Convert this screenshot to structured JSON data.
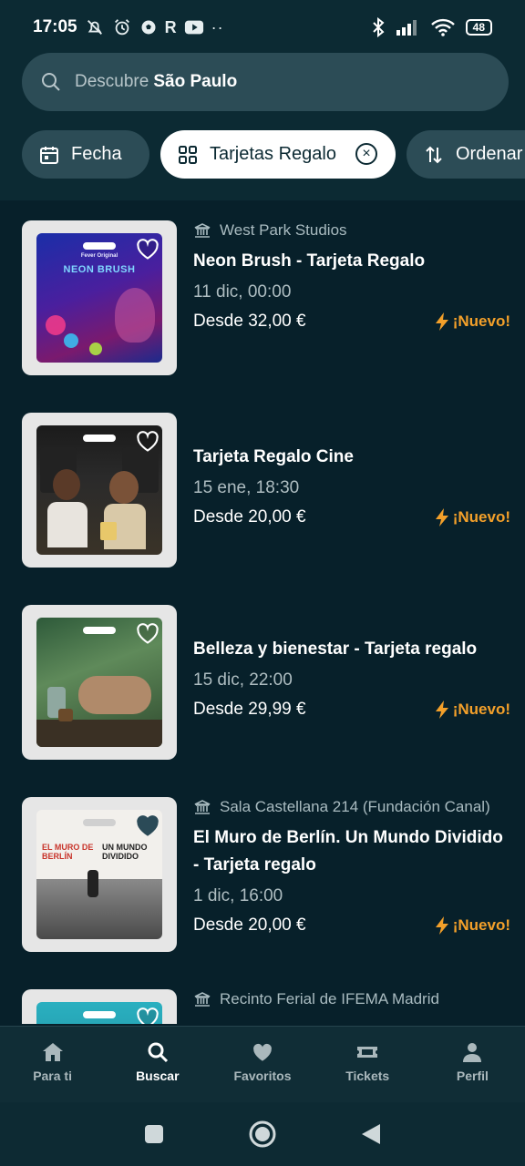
{
  "status_bar": {
    "time": "17:05",
    "left_icons": [
      "bell-off-icon",
      "alarm-icon",
      "soccer-icon",
      "r-icon",
      "youtube-icon",
      "more-dots-icon"
    ],
    "right_icons": [
      "bluetooth-icon",
      "signal-icon",
      "wifi-icon"
    ],
    "battery": "48"
  },
  "search": {
    "prefix": "Descubre",
    "city": "São Paulo"
  },
  "filters": {
    "date_label": "Fecha",
    "gift_label": "Tarjetas Regalo",
    "sort_label": "Ordenar"
  },
  "events": [
    {
      "venue": "West Park Studios",
      "title": "Neon Brush - Tarjeta Regalo",
      "date": "11 dic, 00:00",
      "price": "Desde 32,00 €",
      "badge": "¡Nuevo!",
      "card_text": "NEON BRUSH",
      "card_subtext": "Fever Original"
    },
    {
      "venue": "",
      "title": "Tarjeta Regalo Cine",
      "date": "15 ene, 18:30",
      "price": "Desde 20,00 €",
      "badge": "¡Nuevo!"
    },
    {
      "venue": "",
      "title": "Belleza y bienestar - Tarjeta regalo",
      "date": "15 dic, 22:00",
      "price": "Desde 29,99 €",
      "badge": "¡Nuevo!"
    },
    {
      "venue": "Sala Castellana 214 (Fundación Canal)",
      "title": "El Muro de Berlín. Un Mundo Dividido - Tarjeta regalo",
      "date": "1 dic, 16:00",
      "price": "Desde 20,00 €",
      "badge": "¡Nuevo!",
      "card_text_left": "EL MURO DE BERLÍN",
      "card_text_right": "UN MUNDO DIVIDIDO"
    },
    {
      "venue": "Recinto Ferial de IFEMA Madrid"
    }
  ],
  "bottom_nav": [
    {
      "label": "Para ti",
      "icon": "home-icon"
    },
    {
      "label": "Buscar",
      "icon": "search-icon",
      "active": true
    },
    {
      "label": "Favoritos",
      "icon": "heart-icon"
    },
    {
      "label": "Tickets",
      "icon": "ticket-icon"
    },
    {
      "label": "Perfil",
      "icon": "person-icon"
    }
  ],
  "colors": {
    "background": "#07202a",
    "header": "#0c2a33",
    "chip": "#2c4c56",
    "accent_badge": "#f3a02a"
  }
}
